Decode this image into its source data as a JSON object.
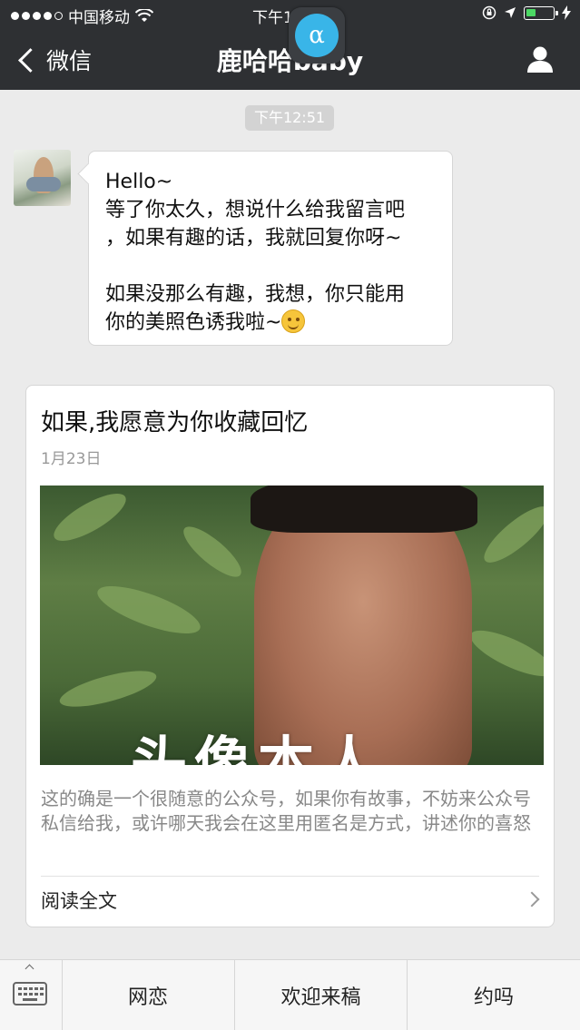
{
  "status_bar": {
    "carrier": "中国移动",
    "time": "下午12:52"
  },
  "nav": {
    "back_label": "微信",
    "title": "鹿哈哈baby",
    "user_icon": "person-icon",
    "overlay_badge": "α"
  },
  "chat": {
    "timestamp": "下午12:51",
    "message_lines": [
      "Hello~",
      "等了你太久，想说什么给我留言吧",
      "，如果有趣的话，我就回复你呀~",
      "",
      "如果没那么有趣，我想，你只能用",
      "你的美照色诱我啦~"
    ],
    "emoji": "smiley-icon"
  },
  "article": {
    "title": "如果,我愿意为你收藏回忆",
    "date": "1月23日",
    "image_caption": "头像本人",
    "description": "这的确是一个很随意的公众号，如果你有故事，不妨来公众号私信给我，或许哪天我会在这里用匿名是方式，讲述你的喜怒",
    "read_more": "阅读全文"
  },
  "bottom_menu": {
    "keyboard_icon": "keyboard-icon",
    "items": [
      "网恋",
      "欢迎来稿",
      "约吗"
    ]
  },
  "colors": {
    "nav_bg": "#2e3033",
    "chat_bg": "#ebebeb",
    "battery": "#4cd964",
    "overlay": "#39b5e8"
  }
}
